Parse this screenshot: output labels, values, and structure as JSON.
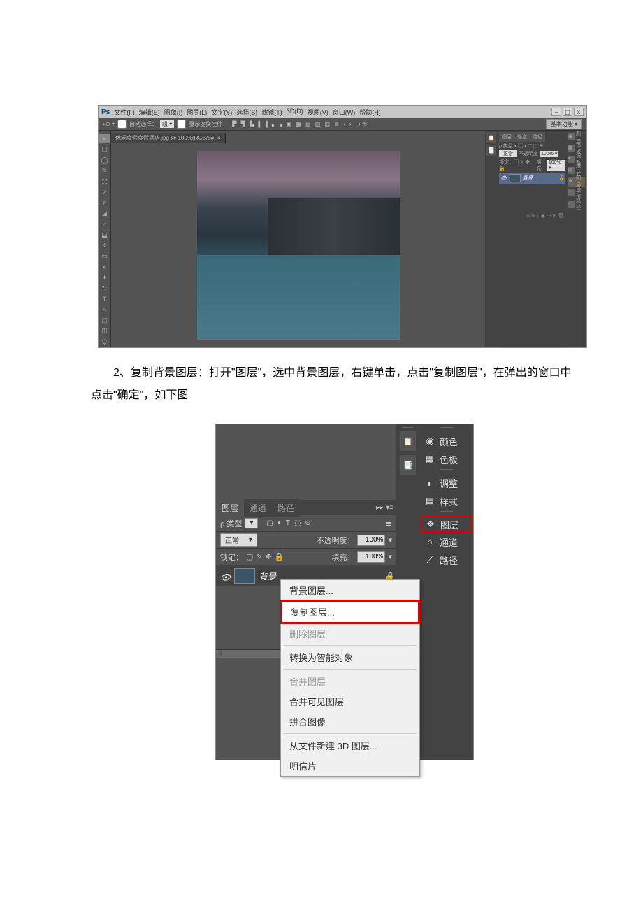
{
  "ps": {
    "logo": "Ps",
    "menu": [
      "文件(F)",
      "编辑(E)",
      "图像(I)",
      "图层(L)",
      "文字(Y)",
      "选择(S)",
      "滤镜(T)",
      "3D(D)",
      "视图(V)",
      "窗口(W)",
      "帮助(H)"
    ],
    "winbtns": [
      "–",
      "▢",
      "x"
    ],
    "options": {
      "move": "▸⊕ ▾",
      "autoSelect": "自动选择：",
      "autoSelectVal": "组  ▾",
      "showTransform": "显示变换控件",
      "right": "基本功能 ▾"
    },
    "doctab": "休闲度假度假酒店.jpg @ 100%(RGB/8#) ×",
    "tools": [
      "▸",
      "▢",
      "◯",
      "✎",
      "⬚",
      "↗",
      "✐",
      "◢",
      "⟋",
      "⬓",
      "✧",
      "▭",
      "◐",
      "✦",
      "↻",
      "T",
      "↖",
      "▢",
      "◫",
      "Q"
    ],
    "rcol1": [
      "📋",
      "📑"
    ],
    "rcol3": [
      {
        "icon": "◉",
        "label": "颜色"
      },
      {
        "icon": "▦",
        "label": "色板"
      },
      {
        "icon": "◐",
        "label": "调整"
      },
      {
        "icon": "▤",
        "label": "样式"
      },
      {
        "icon": "❖",
        "label": "图层",
        "hilite": true
      },
      {
        "icon": "○",
        "label": "通道"
      },
      {
        "icon": "⟋",
        "label": "路径"
      }
    ],
    "layerpanel": {
      "tabs": [
        "图层",
        "通道",
        "路径"
      ],
      "typerow": "ρ 类型  ▾   ▢ ◐ T ⬚ ⊕",
      "blendrow": {
        "mode": "正常",
        "opacity": "不透明度",
        "opval": "100% ▾"
      },
      "lockrow": {
        "lock": "锁定：▢ ✎ ✥ 🔒",
        "fill": "填充",
        "fillval": "100% ▾"
      },
      "layer": {
        "eye": "👁",
        "name": "背景",
        "lock": "🔒"
      },
      "bottom": "∞ fx ◐ ◉ ▭ ⊞ 🗑"
    }
  },
  "instruction": "　　2、复制背景图层：打开\"图层\"，选中背景图层，右键单击，点击\"复制图层\"，在弹出的窗口中点击\"确定\"，如下图",
  "ss2": {
    "tabs": [
      "图层",
      "通道",
      "路径"
    ],
    "tabIcons": [
      "▸▸",
      "▾≡"
    ],
    "row1": {
      "label": "ρ 类型",
      "icons": [
        "▢",
        "◐",
        "T",
        "⬚",
        "⊕",
        "≣"
      ]
    },
    "row2": {
      "mode": "正常",
      "opacity": "不透明度：",
      "opval": "100%"
    },
    "row3": {
      "lock": "锁定：",
      "icons": [
        "▢",
        "✎",
        "✥",
        "🔒"
      ],
      "fill": "填充：",
      "fillval": "100%"
    },
    "layer": {
      "name": "背景",
      "lock": "🔒"
    },
    "ctx": [
      {
        "label": "背景图层...",
        "type": "item"
      },
      {
        "label": "复制图层...",
        "type": "highlight"
      },
      {
        "label": "删除图层",
        "type": "disabled"
      },
      {
        "type": "sep"
      },
      {
        "label": "转换为智能对象",
        "type": "item"
      },
      {
        "type": "sep"
      },
      {
        "label": "合并图层",
        "type": "disabled"
      },
      {
        "label": "合并可见图层",
        "type": "item"
      },
      {
        "label": "拼合图像",
        "type": "item"
      },
      {
        "type": "sep"
      },
      {
        "label": "从文件新建 3D 图层...",
        "type": "item"
      },
      {
        "label": "明信片",
        "type": "item"
      }
    ],
    "col1": [
      "📋",
      "📑"
    ],
    "col2": [
      {
        "icon": "◉",
        "label": "颜色"
      },
      {
        "icon": "▦",
        "label": "色板"
      },
      {
        "icon": "◐",
        "label": "调整"
      },
      {
        "icon": "▤",
        "label": "样式"
      },
      {
        "icon": "❖",
        "label": "图层",
        "hilite": true
      },
      {
        "icon": "○",
        "label": "通道"
      },
      {
        "icon": "⟋",
        "label": "路径"
      }
    ]
  }
}
